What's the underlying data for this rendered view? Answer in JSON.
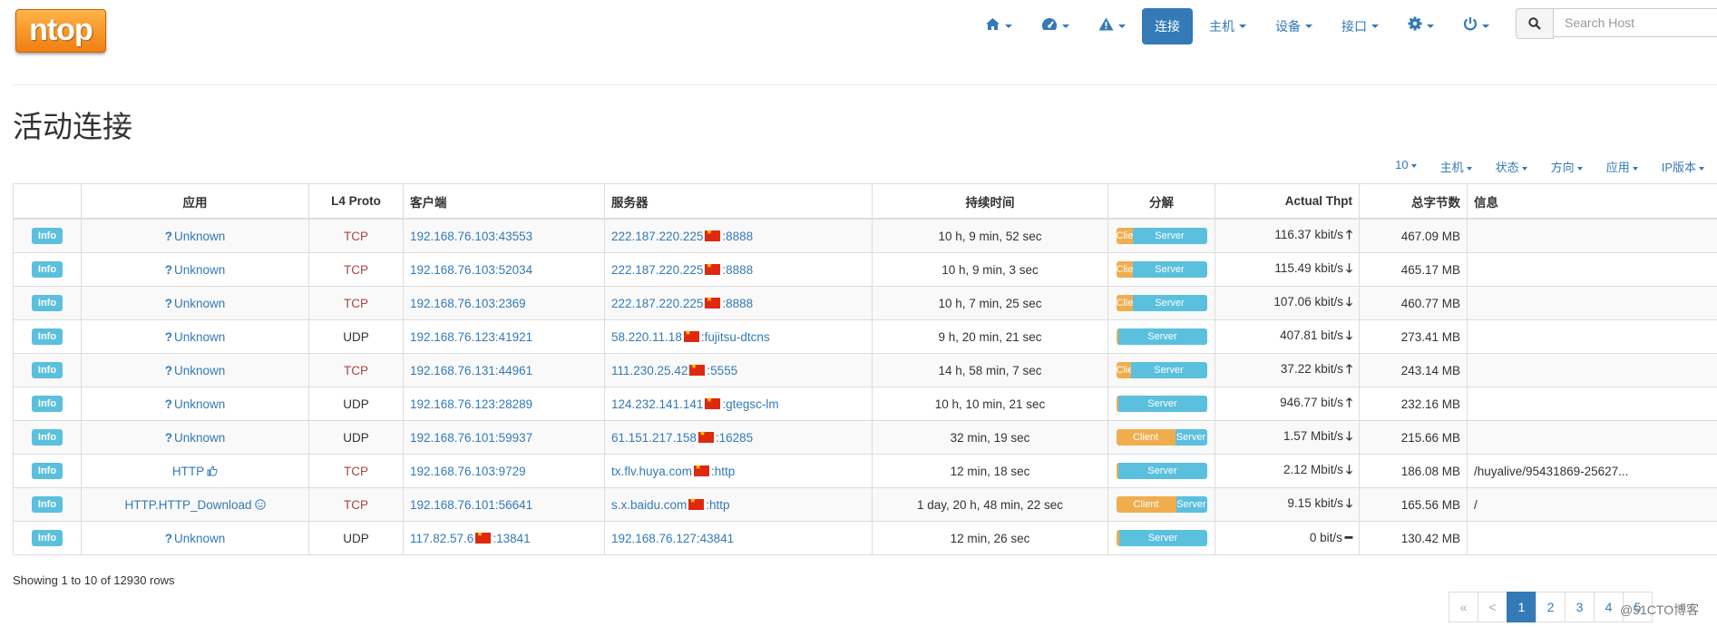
{
  "brand": {
    "logo_text": "ntop"
  },
  "nav": {
    "home_icon": "home-icon",
    "dashboard_icon": "dashboard-icon",
    "alerts_icon": "warning-icon",
    "flows": "连接",
    "hosts": "主机",
    "devices": "设备",
    "interfaces": "接口",
    "settings_icon": "gear-icon",
    "power_icon": "power-icon"
  },
  "search": {
    "placeholder": "Search Host"
  },
  "page": {
    "title": "活动连接"
  },
  "filters": {
    "page_size": "10",
    "hosts": "主机",
    "status": "状态",
    "direction": "方向",
    "application": "应用",
    "ip_version": "IP版本"
  },
  "table": {
    "headers": {
      "info": "",
      "app": "应用",
      "proto": "L4 Proto",
      "client": "客户端",
      "server": "服务器",
      "duration": "持续时间",
      "breakdown": "分解",
      "thpt": "Actual Thpt",
      "bytes": "总字节数",
      "extra": "信息"
    },
    "rows": [
      {
        "info": "Info",
        "app": "Unknown",
        "app_icon": "question-icon",
        "proto": "TCP",
        "client": "192.168.76.103:43553",
        "client_flag": false,
        "server_ip": "222.187.220.225",
        "server_port": ":8888",
        "server_flag": true,
        "duration": "10 h, 9 min, 52 sec",
        "client_pct": 18,
        "client_label": "Clie",
        "server_label": "Server",
        "thpt": "116.37 kbit/s",
        "trend": "up",
        "bytes": "467.09 MB",
        "extra": ""
      },
      {
        "info": "Info",
        "app": "Unknown",
        "app_icon": "question-icon",
        "proto": "TCP",
        "client": "192.168.76.103:52034",
        "client_flag": false,
        "server_ip": "222.187.220.225",
        "server_port": ":8888",
        "server_flag": true,
        "duration": "10 h, 9 min, 3 sec",
        "client_pct": 18,
        "client_label": "Clie",
        "server_label": "Server",
        "thpt": "115.49 kbit/s",
        "trend": "down",
        "bytes": "465.17 MB",
        "extra": ""
      },
      {
        "info": "Info",
        "app": "Unknown",
        "app_icon": "question-icon",
        "proto": "TCP",
        "client": "192.168.76.103:2369",
        "client_flag": false,
        "server_ip": "222.187.220.225",
        "server_port": ":8888",
        "server_flag": true,
        "duration": "10 h, 7 min, 25 sec",
        "client_pct": 18,
        "client_label": "Clie",
        "server_label": "Server",
        "thpt": "107.06 kbit/s",
        "trend": "down",
        "bytes": "460.77 MB",
        "extra": ""
      },
      {
        "info": "Info",
        "app": "Unknown",
        "app_icon": "question-icon",
        "proto": "UDP",
        "client": "192.168.76.123:41921",
        "client_flag": false,
        "server_ip": "58.220.11.18",
        "server_port": ":fujitsu-dtcns",
        "server_flag": true,
        "duration": "9 h, 20 min, 21 sec",
        "client_pct": 2,
        "client_label": "",
        "server_label": "Server",
        "thpt": "407.81 bit/s",
        "trend": "down",
        "bytes": "273.41 MB",
        "extra": ""
      },
      {
        "info": "Info",
        "app": "Unknown",
        "app_icon": "question-icon",
        "proto": "TCP",
        "client": "192.168.76.131:44961",
        "client_flag": false,
        "server_ip": "111.230.25.42",
        "server_port": ":5555",
        "server_flag": true,
        "duration": "14 h, 58 min, 7 sec",
        "client_pct": 16,
        "client_label": "Clie",
        "server_label": "Server",
        "thpt": "37.22 kbit/s",
        "trend": "up",
        "bytes": "243.14 MB",
        "extra": ""
      },
      {
        "info": "Info",
        "app": "Unknown",
        "app_icon": "question-icon",
        "proto": "UDP",
        "client": "192.168.76.123:28289",
        "client_flag": false,
        "server_ip": "124.232.141.141",
        "server_port": ":gtegsc-lm",
        "server_flag": true,
        "duration": "10 h, 10 min, 21 sec",
        "client_pct": 2,
        "client_label": "",
        "server_label": "Server",
        "thpt": "946.77 bit/s",
        "trend": "up",
        "bytes": "232.16 MB",
        "extra": ""
      },
      {
        "info": "Info",
        "app": "Unknown",
        "app_icon": "question-icon",
        "proto": "UDP",
        "client": "192.168.76.101:59937",
        "client_flag": false,
        "server_ip": "61.151.217.158",
        "server_port": ":16285",
        "server_flag": true,
        "duration": "32 min, 19 sec",
        "client_pct": 65,
        "client_label": "Client",
        "server_label": "Server",
        "thpt": "1.57 Mbit/s",
        "trend": "down",
        "bytes": "215.66 MB",
        "extra": ""
      },
      {
        "info": "Info",
        "app": "HTTP",
        "app_icon": "thumbs-up-icon",
        "proto": "TCP",
        "client": "192.168.76.103:9729",
        "client_flag": false,
        "server_ip": "tx.flv.huya.com",
        "server_port": ":http",
        "server_flag": true,
        "duration": "12 min, 18 sec",
        "client_pct": 2,
        "client_label": "",
        "server_label": "Server",
        "thpt": "2.12 Mbit/s",
        "trend": "down",
        "bytes": "186.08 MB",
        "extra": "/huyalive/95431869-25627..."
      },
      {
        "info": "Info",
        "app": "HTTP.HTTP_Download",
        "app_icon": "smile-icon",
        "proto": "TCP",
        "client": "192.168.76.101:56641",
        "client_flag": false,
        "server_ip": "s.x.baidu.com",
        "server_port": ":http",
        "server_flag": true,
        "duration": "1 day, 20 h, 48 min, 22 sec",
        "client_pct": 66,
        "client_label": "Client",
        "server_label": "Server",
        "thpt": "9.15 kbit/s",
        "trend": "down",
        "bytes": "165.56 MB",
        "extra": "/"
      },
      {
        "info": "Info",
        "app": "Unknown",
        "app_icon": "question-icon",
        "proto": "UDP",
        "client": "117.82.57.6",
        "client_port": ":13841",
        "client_flag": true,
        "server_ip": "192.168.76.127:43841",
        "server_port": "",
        "server_flag": false,
        "duration": "12 min, 26 sec",
        "client_pct": 3,
        "client_label": "",
        "server_label": "Server",
        "thpt": "0 bit/s",
        "trend": "flat",
        "bytes": "130.42 MB",
        "extra": ""
      }
    ]
  },
  "footer": {
    "showing": "Showing 1 to 10 of 12930 rows"
  },
  "pagination": {
    "first": "«",
    "prev": "<",
    "pages": [
      "1",
      "2",
      "3",
      "4",
      "5"
    ],
    "active_page": "1"
  },
  "watermark": "@51CTO博客",
  "colors": {
    "accent": "#337ab7",
    "info": "#5bc0de",
    "client_bar": "#f0ad4e",
    "tcp": "#a94442",
    "logo": "#f7941d"
  }
}
